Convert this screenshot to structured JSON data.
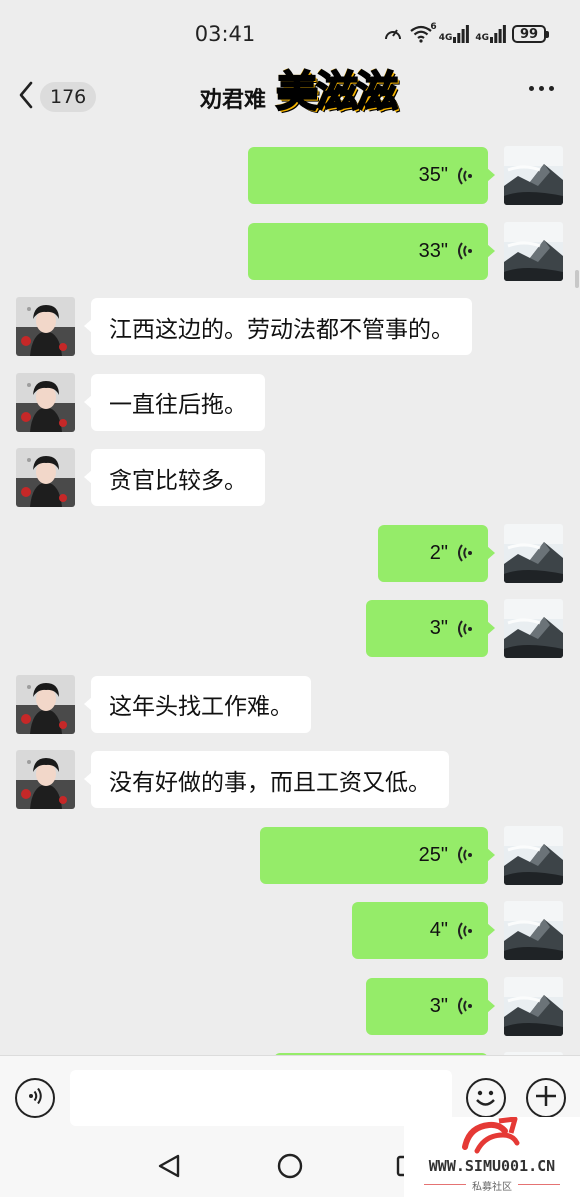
{
  "status_bar": {
    "time": "03:41",
    "network_1": "4G",
    "network_2": "4G",
    "wifi_num": "6",
    "battery": "99"
  },
  "header": {
    "unread_count": "176",
    "title": "劝君难",
    "sticker_text": "美滋滋"
  },
  "messages": [
    {
      "dir": "out",
      "type": "voice",
      "duration": "35\""
    },
    {
      "dir": "out",
      "type": "voice",
      "duration": "33\""
    },
    {
      "dir": "in",
      "type": "text",
      "text": "江西这边的。劳动法都不管事的。"
    },
    {
      "dir": "in",
      "type": "text",
      "text": "一直往后拖。"
    },
    {
      "dir": "in",
      "type": "text",
      "text": "贪官比较多。"
    },
    {
      "dir": "out",
      "type": "voice",
      "duration": "2\""
    },
    {
      "dir": "out",
      "type": "voice",
      "duration": "3\""
    },
    {
      "dir": "in",
      "type": "text",
      "text": "这年头找工作难。"
    },
    {
      "dir": "in",
      "type": "text",
      "text": "没有好做的事，而且工资又低。"
    },
    {
      "dir": "out",
      "type": "voice",
      "duration": "25\""
    },
    {
      "dir": "out",
      "type": "voice",
      "duration": "4\""
    },
    {
      "dir": "out",
      "type": "voice",
      "duration": "3\""
    },
    {
      "dir": "out",
      "type": "voice",
      "duration": ""
    }
  ],
  "input": {
    "placeholder": ""
  },
  "watermark": {
    "url": "WWW.SIMU001.CN",
    "subtitle": "私募社区"
  },
  "colors": {
    "background": "#ededed",
    "outgoing_bubble": "#95ec69",
    "incoming_bubble": "#ffffff",
    "sticker_red": "#e61e1e"
  },
  "icons": {
    "back": "chevron-left-icon",
    "more": "more-dots-icon",
    "voice": "voice-wave-icon",
    "emoji": "smile-icon",
    "plus": "plus-icon",
    "nav_back": "triangle-back-icon",
    "nav_home": "circle-home-icon",
    "nav_recent": "square-recent-icon"
  }
}
